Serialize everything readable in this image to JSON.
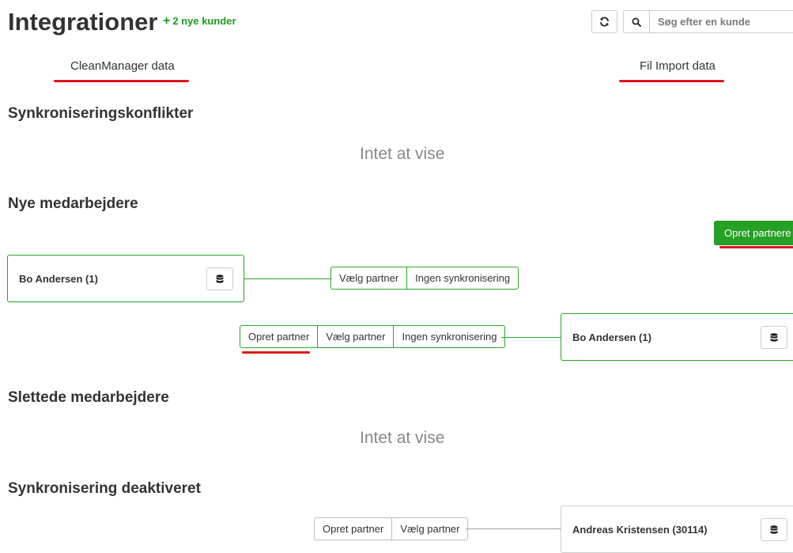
{
  "header": {
    "title": "Integrationer",
    "new_customers": "2 nye kunder",
    "new_customers_icon": "plus-icon",
    "refresh_icon": "refresh-icon",
    "search": {
      "icon": "search-icon",
      "placeholder": "Søg efter en kunde"
    }
  },
  "columns": {
    "left": "CleanManager data",
    "right": "Fil Import data",
    "accent": "#e0141c"
  },
  "sections": {
    "conflicts": {
      "title": "Synkroniseringskonflikter",
      "empty": "Intet at vise"
    },
    "new_employees": {
      "title": "Nye medarbejdere",
      "create_partners_button": "Opret partnere",
      "row1": {
        "card_label": "Bo Andersen (1)",
        "actions": [
          "Vælg partner",
          "Ingen synkronisering"
        ]
      },
      "row2": {
        "actions": [
          "Opret partner",
          "Vælg partner",
          "Ingen synkronisering"
        ],
        "card_label": "Bo Andersen (1)"
      }
    },
    "deleted_employees": {
      "title": "Slettede medarbejdere",
      "empty": "Intet at vise"
    },
    "sync_disabled": {
      "title": "Synkronisering deaktiveret",
      "row1": {
        "actions": [
          "Opret partner",
          "Vælg partner"
        ],
        "card_label": "Andreas Kristensen (30114)"
      }
    }
  },
  "colors": {
    "success": "#25a225",
    "card_border": "#2ea52e",
    "muted": "#888888"
  }
}
